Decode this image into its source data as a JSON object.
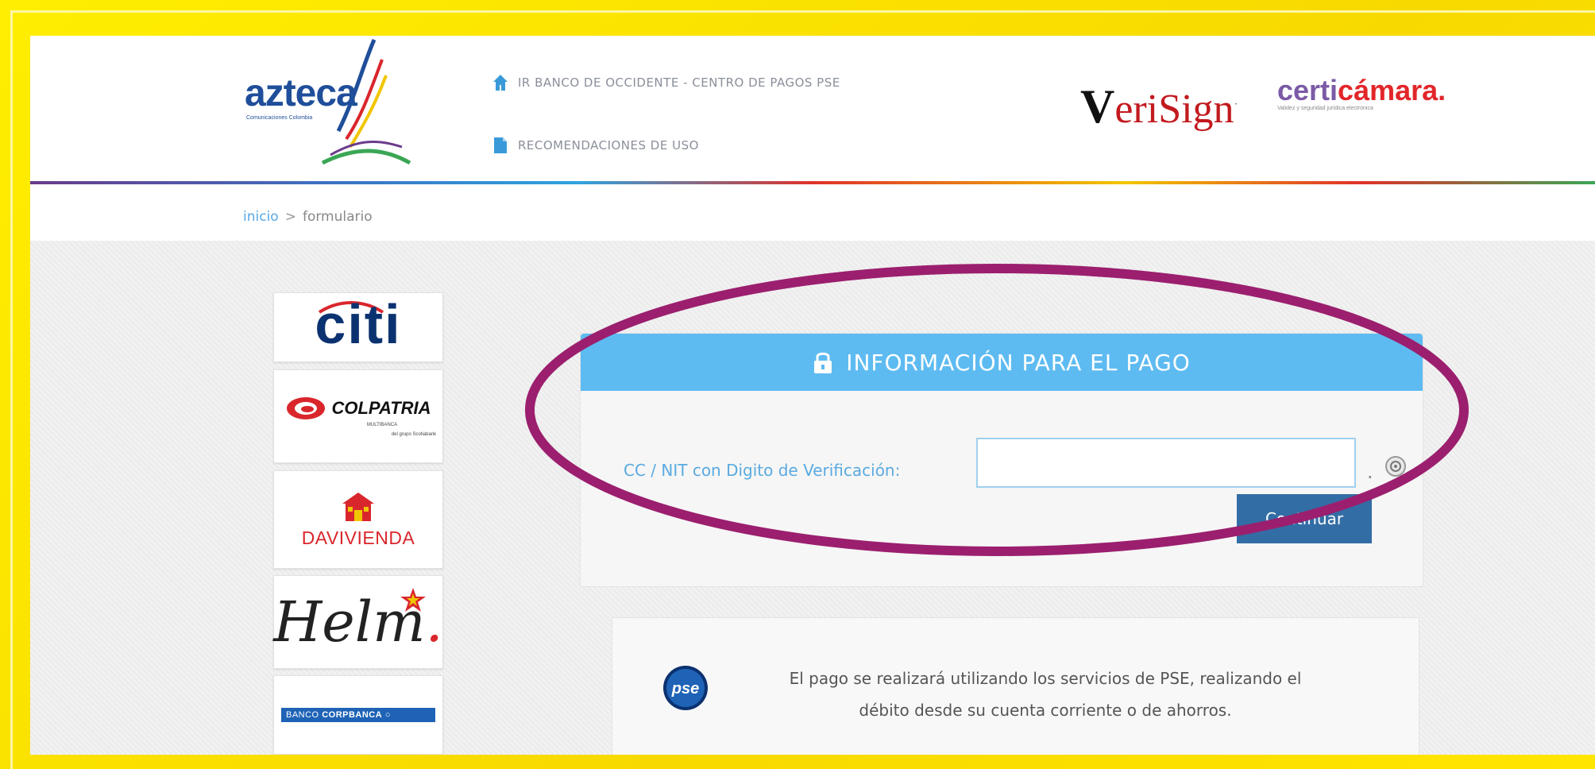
{
  "header": {
    "logo": {
      "name": "azteca",
      "tagline": "Comunicaciones Colombia"
    },
    "nav": [
      {
        "label": "IR BANCO DE OCCIDENTE - CENTRO DE PAGOS PSE",
        "icon": "home-icon"
      },
      {
        "label": "RECOMENDACIONES DE USO",
        "icon": "document-icon"
      }
    ],
    "partners": {
      "verisign": {
        "v": "V",
        "rest": "eriSign",
        "tm": "·"
      },
      "certicamara": {
        "part1": "certi",
        "part2": "cámara.",
        "tagline": "Validez y seguridad jurídica electrónica"
      }
    }
  },
  "breadcrumb": {
    "home": "inicio",
    "separator": ">",
    "current": "formulario"
  },
  "banks": {
    "citi": "citi",
    "colpatria": {
      "name": "COLPATRIA",
      "sub": "MULTIBANCA",
      "group": "del grupo Scotiabank"
    },
    "davivienda": "DAVIVIENDA",
    "helm": {
      "name": "Helm",
      "dot": "."
    },
    "corpbanca": {
      "prefix": "BANCO",
      "name": "CORPBANCA"
    }
  },
  "payment_form": {
    "title": "INFORMACIÓN PARA EL PAGO",
    "field_label": "CC / NIT con Digito de Verificación:",
    "field_value": "",
    "dot": ".",
    "continue_label": "Continuar"
  },
  "pse_info": {
    "line1": "El pago se realizará utilizando los servicios de PSE, realizando el",
    "line2": "débito desde su cuenta corriente o de ahorros."
  },
  "colors": {
    "frame": "#fde900",
    "header_bar": "#5ebbf1",
    "button": "#336da5",
    "annotation": "#9b1f6e"
  }
}
